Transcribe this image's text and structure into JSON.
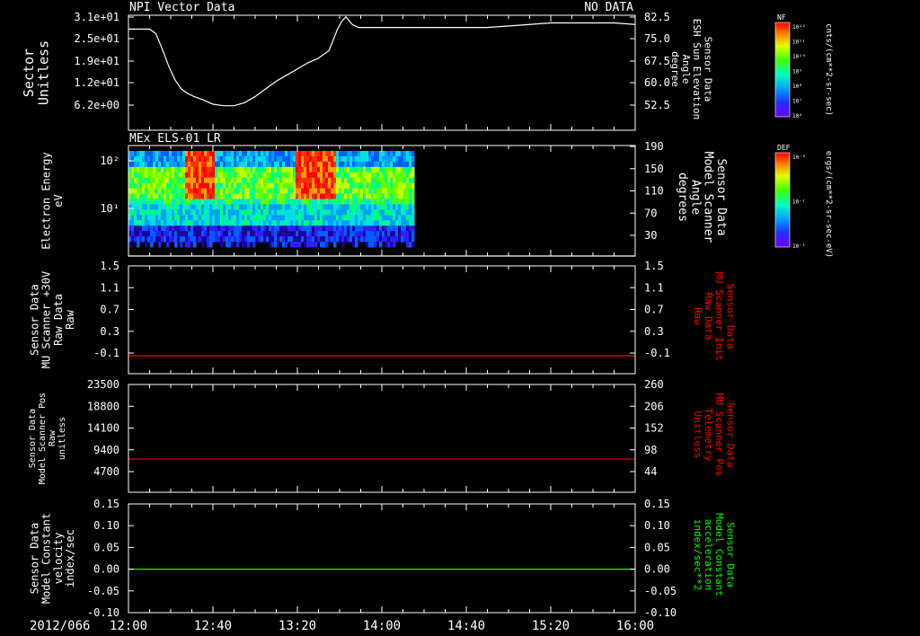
{
  "colors": {
    "white": "#ffffff",
    "red": "#ff0000",
    "green": "#00ff00",
    "background": "#000000"
  },
  "x_axis": {
    "date_label": "2012/066",
    "tick_labels": [
      "12:00",
      "12:40",
      "13:20",
      "14:00",
      "14:40",
      "15:20",
      "16:00"
    ],
    "range_minutes": [
      0,
      240
    ]
  },
  "colorbars": [
    {
      "title": "NF",
      "unit": "cnts/(cm**2-sr-sec)",
      "tick_labels": [
        "10¹²",
        "10¹¹",
        "10¹⁰",
        "10⁹",
        "10⁸",
        "10⁷",
        "10⁶"
      ]
    },
    {
      "title": "DEF",
      "unit": "ergs/(cm**2-sr-sec-eV)",
      "tick_labels": [
        "10⁻³",
        "10⁻¹",
        "10⁻¹"
      ]
    }
  ],
  "chart_data": [
    {
      "type": "line",
      "title": "NPI Vector Data",
      "status": "NO DATA",
      "ylabel": [
        "Sector",
        "Unitless"
      ],
      "ytick_labels": [
        "3.1e+01",
        "2.5e+01",
        "1.9e+01",
        "1.2e+01",
        "6.2e+00"
      ],
      "ylabel_right": [
        "Sensor Data",
        "ESH Sun Elevation",
        "Angle",
        "degree"
      ],
      "ytick_labels_right": [
        "82.5",
        "75.0",
        "67.5",
        "60.0",
        "52.5"
      ],
      "ylim_right": [
        45,
        82.5
      ],
      "grid": false,
      "series": [
        {
          "color": "#ffffff",
          "x": [
            0,
            10,
            13,
            16,
            19,
            22,
            25,
            28,
            31,
            35,
            40,
            45,
            50,
            55,
            60,
            65,
            70,
            75,
            80,
            85,
            90,
            95,
            99,
            101,
            103,
            106,
            109,
            113,
            117,
            120,
            125,
            130,
            150,
            170,
            190,
            200,
            210,
            220,
            230,
            240
          ],
          "y": [
            78,
            78,
            76.5,
            71.5,
            66,
            61.5,
            58.5,
            57,
            56,
            55,
            53.5,
            53,
            53,
            54,
            56,
            58.5,
            61,
            63,
            65,
            67,
            68.5,
            71,
            78,
            80.5,
            82,
            79.5,
            78.5,
            78.5,
            78.5,
            78.5,
            78.5,
            78.5,
            78.5,
            78.5,
            79.5,
            80,
            80,
            80,
            80,
            79.5
          ]
        }
      ]
    },
    {
      "type": "heatmap",
      "title": "MEx ELS-01 LR",
      "ylabel": [
        "Electron Energy",
        "eV"
      ],
      "ytick_labels": [
        "10²",
        "10¹"
      ],
      "ylabel_right": [
        "Sensor Data",
        "Model Scanner",
        "Angle",
        "degrees"
      ],
      "ytick_labels_right": [
        "190",
        "150",
        "110",
        "70",
        "30"
      ],
      "ylim_right": [
        10,
        190
      ],
      "data_x_range": [
        0,
        135
      ],
      "hot_intervals": [
        {
          "x": [
            26,
            40
          ],
          "value": "high"
        },
        {
          "x": [
            79,
            98
          ],
          "value": "high"
        }
      ],
      "series": [
        {
          "color": "#ffffff",
          "x": [
            0,
            240
          ],
          "y": [
            10,
            10
          ]
        }
      ]
    },
    {
      "type": "line",
      "ylabel": [
        "Sensor Data",
        "MU Scanner +30V",
        "Raw Data",
        "Raw"
      ],
      "ytick_labels": [
        "1.5",
        "1.1",
        "0.7",
        "0.3",
        "-0.1"
      ],
      "ylabel_right": [
        "Sensor Data",
        "MU Scanner Init",
        "Raw Data",
        "Raw"
      ],
      "ytick_labels_right": [
        "1.5",
        "1.1",
        "0.7",
        "0.3",
        "-0.1"
      ],
      "ylim": [
        -0.3,
        1.5
      ],
      "series": [
        {
          "color": "#ff0000",
          "x": [
            0,
            240
          ],
          "y": [
            0,
            0
          ]
        }
      ]
    },
    {
      "type": "line",
      "ylabel": [
        "Sensor Data",
        "Model Scanner Pos",
        "Raw",
        "unitless"
      ],
      "ytick_labels": [
        "23500",
        "18800",
        "14100",
        "9400",
        "4700"
      ],
      "ylabel_right": [
        "Sensor Data",
        "MU Scanner Pos",
        "Telemetry",
        "Unitless"
      ],
      "ytick_labels_right": [
        "260",
        "206",
        "152",
        "98",
        "44"
      ],
      "ylim_right": [
        0,
        260
      ],
      "series": [
        {
          "color": "#ff0000",
          "x": [
            0,
            240
          ],
          "y": [
            80,
            80
          ]
        }
      ]
    },
    {
      "type": "line",
      "ylabel": [
        "Sensor Data",
        "Model Constant",
        "velocity",
        "index/sec"
      ],
      "ytick_labels": [
        "0.15",
        "0.10",
        "0.05",
        "0.00",
        "-0.05",
        "-0.10"
      ],
      "ylabel_right": [
        "Sensor Data",
        "Model Constant",
        "acceleration",
        "index/sec**2"
      ],
      "ytick_labels_right": [
        "0.15",
        "0.10",
        "0.05",
        "0.00",
        "-0.05",
        "-0.10"
      ],
      "ylim": [
        -0.1,
        0.15
      ],
      "series": [
        {
          "color": "#00ff00",
          "x": [
            0,
            240
          ],
          "y": [
            0,
            0
          ]
        }
      ]
    }
  ]
}
